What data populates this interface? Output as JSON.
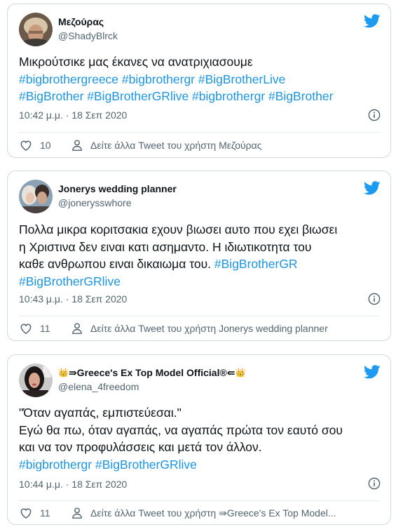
{
  "tweets": [
    {
      "name": "Μεζούρας",
      "handle": "@ShadyBlrck",
      "lines": [
        {
          "text": "Μικρούτσικε μας έκανες να ανατριχιασουμε",
          "tags": ""
        },
        {
          "text": "",
          "tags": "#bigbrothergreece #bigbrothergr #BigBrotherLive"
        },
        {
          "text": "",
          "tags": "#BigBrother #BigBrotherGRlive #bigbrothergr #BigBrother"
        }
      ],
      "time": "10:42 μ.μ. · 18 Σεπ 2020",
      "likes": "10",
      "more_link": "Δείτε άλλα Tweet του χρήστη Μεζούρας"
    },
    {
      "name": "Jonerys wedding planner",
      "handle": "@jonerysswhore",
      "lines": [
        {
          "text": "Πολλα μικρα κοριτσακια εχουν βιωσει αυτο που εχει βιωσει",
          "tags": ""
        },
        {
          "text": "η Χριστινα δεν ειναι κατι ασημαντο. Η ιδιωτικοτητα του",
          "tags": ""
        },
        {
          "text": "καθε ανθρωπου ειναι δικαιωμα του. ",
          "tags": "#BigBrotherGR"
        },
        {
          "text": "",
          "tags": "#BigBrotherGRlive"
        }
      ],
      "time": "10:43 μ.μ. · 18 Σεπ 2020",
      "likes": "11",
      "more_link": "Δείτε άλλα Tweet του χρήστη Jonerys wedding planner"
    },
    {
      "name": "⇛Greece's Ex Top Model Official®⇚",
      "handle": "@elena_4freedom",
      "lines": [
        {
          "text": "\"Όταν αγαπάς, εμπιστεύεσαι.\"",
          "tags": ""
        },
        {
          "text": "Εγώ θα πω, όταν αγαπάς, να αγαπάς πρώτα τον εαυτό σου",
          "tags": ""
        },
        {
          "text": "και να τον προφυλάσσεις και μετά τον άλλον.",
          "tags": ""
        },
        {
          "text": "",
          "tags": "#bigbrothergr  #BigBrotherGRlive"
        }
      ],
      "time": "10:44 μ.μ. · 18 Σεπ 2020",
      "likes": "11",
      "more_link": "Δείτε άλλα Tweet του χρήστη ⇛Greece's Ex Top Model..."
    }
  ],
  "icons": {
    "bird": "twitter-bird-icon",
    "info": "info-icon",
    "heart": "heart-icon",
    "person": "person-icon",
    "crown": "crown-icon"
  },
  "colors": {
    "hashtag": "#1b95e0",
    "bird": "#1d9bf0",
    "muted": "#536471",
    "border": "#cfd9de"
  }
}
